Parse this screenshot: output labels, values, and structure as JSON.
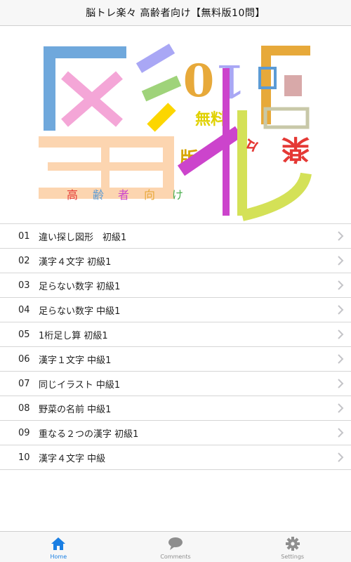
{
  "header": {
    "title": "脳トレ楽々 高齢者向け【無料版10問】"
  },
  "banner": {
    "logo_text": "脳トレ楽々 無料版 10問 高齢者向け"
  },
  "menu": {
    "items": [
      {
        "num": "01",
        "label": "違い探し図形　初級1"
      },
      {
        "num": "02",
        "label": "漢字４文字 初級1"
      },
      {
        "num": "03",
        "label": "足らない数字 初級1"
      },
      {
        "num": "04",
        "label": "足らない数字 中級1"
      },
      {
        "num": "05",
        "label": "1桁足し算 初級1"
      },
      {
        "num": "06",
        "label": "漢字１文字 中級1"
      },
      {
        "num": "07",
        "label": "同じイラスト 中級1"
      },
      {
        "num": "08",
        "label": "野菜の名前 中級1"
      },
      {
        "num": "09",
        "label": "重なる２つの漢字 初級1"
      },
      {
        "num": "10",
        "label": "漢字４文字 中級"
      }
    ]
  },
  "tabbar": {
    "tabs": [
      {
        "label": "Home",
        "icon": "home-icon",
        "active": true
      },
      {
        "label": "Comments",
        "icon": "comments-icon",
        "active": false
      },
      {
        "label": "Settings",
        "icon": "gear-icon",
        "active": false
      }
    ]
  },
  "colors": {
    "accent": "#1a7fe3",
    "separator": "#d6d6d6",
    "chevron": "#c4c4c8"
  }
}
